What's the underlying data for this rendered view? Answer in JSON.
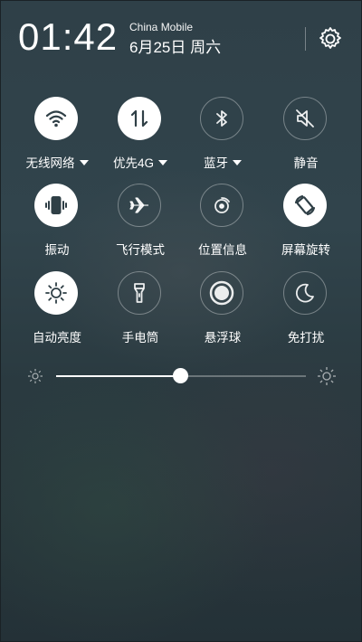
{
  "status": {
    "time": "01:42",
    "carrier": "China Mobile",
    "date": "6月25日 周六"
  },
  "toggles": [
    {
      "label": "无线网络",
      "icon": "wifi-icon",
      "state": "on",
      "dropdown": true
    },
    {
      "label": "优先4G",
      "icon": "mobile-data-icon",
      "state": "on",
      "dropdown": true
    },
    {
      "label": "蓝牙",
      "icon": "bluetooth-icon",
      "state": "off",
      "dropdown": true
    },
    {
      "label": "静音",
      "icon": "mute-icon",
      "state": "off",
      "dropdown": false
    },
    {
      "label": "振动",
      "icon": "vibrate-icon",
      "state": "on",
      "dropdown": false
    },
    {
      "label": "飞行模式",
      "icon": "airplane-icon",
      "state": "off",
      "dropdown": false
    },
    {
      "label": "位置信息",
      "icon": "location-icon",
      "state": "off",
      "dropdown": false
    },
    {
      "label": "屏幕旋转",
      "icon": "rotate-icon",
      "state": "on",
      "dropdown": false
    },
    {
      "label": "自动亮度",
      "icon": "auto-brightness-icon",
      "state": "on",
      "dropdown": false
    },
    {
      "label": "手电筒",
      "icon": "flashlight-icon",
      "state": "off",
      "dropdown": false
    },
    {
      "label": "悬浮球",
      "icon": "floating-ball-icon",
      "state": "off",
      "dropdown": false
    },
    {
      "label": "免打扰",
      "icon": "do-not-disturb-icon",
      "state": "off",
      "dropdown": false
    }
  ],
  "brightness": {
    "value_fraction": 0.5
  },
  "colors": {
    "active_tile": "#ffffff",
    "active_icon": "#2f3f46",
    "inactive_ring": "rgba(255,255,255,0.35)"
  }
}
